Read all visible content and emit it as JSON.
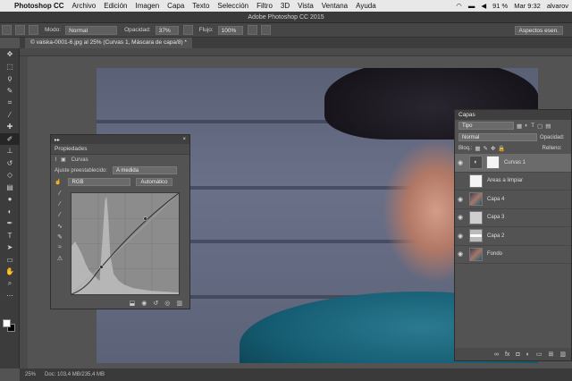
{
  "menubar": {
    "app": "Photoshop CC",
    "items": [
      "Archivo",
      "Edición",
      "Imagen",
      "Capa",
      "Texto",
      "Selección",
      "Filtro",
      "3D",
      "Vista",
      "Ventana",
      "Ayuda"
    ],
    "battery": "91 %",
    "time": "Mar 9:32",
    "user": "alvarov"
  },
  "window": {
    "title": "Adobe Photoshop CC 2015"
  },
  "options": {
    "mode_label": "Modo:",
    "mode_value": "Normal",
    "opacity_label": "Opacidad:",
    "opacity_value": "37%",
    "flow_label": "Flujo:",
    "flow_value": "100%",
    "workspace": "Aspectos esen."
  },
  "document": {
    "tab_label": "© vaiska-0001-6.jpg al 25% (Curvas 1, Máscara de capa/8) *"
  },
  "status": {
    "zoom": "25%",
    "doc_size": "Doc: 103,4 MB/235,4 MB"
  },
  "properties": {
    "title": "Propiedades",
    "adjustment": "Curvas",
    "preset_label": "Ajuste preestablecido:",
    "preset_value": "A medida",
    "channel": "RGB",
    "auto_button": "Automático"
  },
  "layers": {
    "title": "Capas",
    "filter": "Tipo",
    "blend": "Normal",
    "opacity_label": "Opacidad:",
    "lock_label": "Bloq.:",
    "fill_label": "Relleno:",
    "items": [
      {
        "name": "Curvas 1",
        "thumb": "adj",
        "selected": true,
        "visible": true
      },
      {
        "name": "Areas a limpiar",
        "thumb": "white",
        "selected": false,
        "visible": false
      },
      {
        "name": "Capa 4",
        "thumb": "photo",
        "selected": false,
        "visible": true
      },
      {
        "name": "Capa 3",
        "thumb": "gray",
        "selected": false,
        "visible": true
      },
      {
        "name": "Capa 2",
        "thumb": "stroke",
        "selected": false,
        "visible": true
      },
      {
        "name": "Fondo",
        "thumb": "photo",
        "selected": false,
        "visible": true
      }
    ]
  },
  "icons": {
    "toolbar": [
      "move-icon",
      "marquee-icon",
      "lasso-icon",
      "quick-select-icon",
      "crop-icon",
      "eyedropper-icon",
      "healing-brush-icon",
      "brush-icon",
      "clone-stamp-icon",
      "history-brush-icon",
      "eraser-icon",
      "gradient-icon",
      "blur-icon",
      "dodge-icon",
      "pen-icon",
      "type-icon",
      "path-select-icon",
      "shape-icon",
      "hand-icon",
      "zoom-icon",
      "more-tools-icon"
    ]
  }
}
